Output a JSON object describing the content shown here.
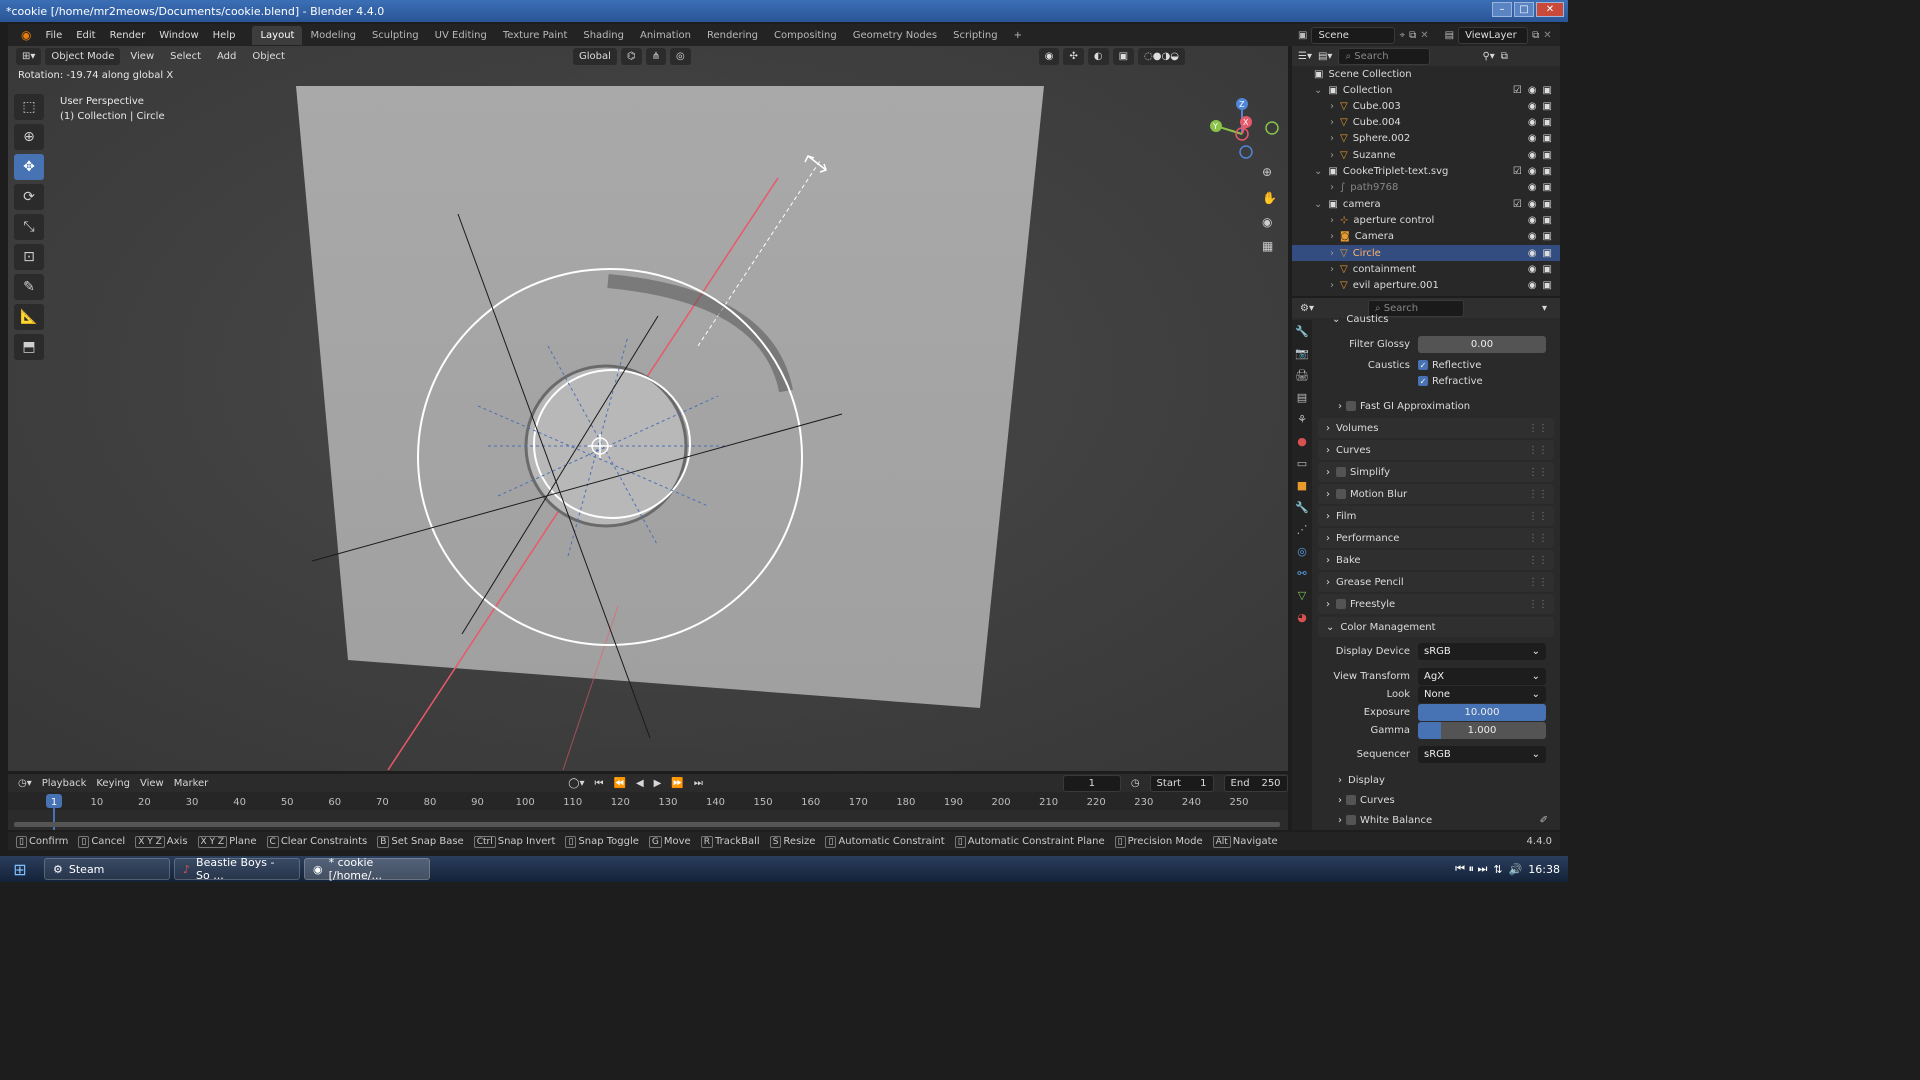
{
  "window": {
    "title": "*cookie [/home/mr2meows/Documents/cookie.blend] - Blender 4.4.0"
  },
  "menu": [
    "File",
    "Edit",
    "Render",
    "Window",
    "Help"
  ],
  "workspaces": [
    "Layout",
    "Modeling",
    "Sculpting",
    "UV Editing",
    "Texture Paint",
    "Shading",
    "Animation",
    "Rendering",
    "Compositing",
    "Geometry Nodes",
    "Scripting"
  ],
  "active_workspace": "Layout",
  "scene": {
    "scene_name": "Scene",
    "view_layer": "ViewLayer"
  },
  "viewport": {
    "mode": "Object Mode",
    "menus": [
      "View",
      "Select",
      "Add",
      "Object"
    ],
    "transform_orientation": "Global",
    "operator_hint": "Rotation: -19.74 along global X",
    "perspective": "User Perspective",
    "context": "(1) Collection | Circle",
    "gizmo_axes": {
      "x": "X",
      "y": "Y",
      "z": "Z"
    }
  },
  "outliner": {
    "search_placeholder": "Search",
    "root": "Scene Collection",
    "rows": [
      {
        "label": "Collection",
        "indent": 1,
        "kind": "collection"
      },
      {
        "label": "Cube.003",
        "indent": 2,
        "kind": "mesh"
      },
      {
        "label": "Cube.004",
        "indent": 2,
        "kind": "mesh"
      },
      {
        "label": "Sphere.002",
        "indent": 2,
        "kind": "mesh"
      },
      {
        "label": "Suzanne",
        "indent": 2,
        "kind": "mesh"
      },
      {
        "label": "CookeTriplet-text.svg",
        "indent": 1,
        "kind": "collection"
      },
      {
        "label": "path9768",
        "indent": 2,
        "kind": "curve"
      },
      {
        "label": "camera",
        "indent": 1,
        "kind": "collection"
      },
      {
        "label": "aperture control",
        "indent": 2,
        "kind": "empty"
      },
      {
        "label": "Camera",
        "indent": 2,
        "kind": "camera"
      },
      {
        "label": "Circle",
        "indent": 2,
        "kind": "mesh",
        "selected": true
      },
      {
        "label": "containment",
        "indent": 2,
        "kind": "mesh"
      },
      {
        "label": "evil aperture.001",
        "indent": 2,
        "kind": "mesh"
      }
    ]
  },
  "properties": {
    "search_placeholder": "Search",
    "caustics_header": "Caustics",
    "filter_glossy_label": "Filter Glossy",
    "filter_glossy_value": "0.00",
    "caustics_label": "Caustics",
    "reflective": "Reflective",
    "refractive": "Refractive",
    "fast_gi": "Fast GI Approximation",
    "panels": [
      "Volumes",
      "Curves",
      "Simplify",
      "Motion Blur",
      "Film",
      "Performance",
      "Bake",
      "Grease Pencil",
      "Freestyle"
    ],
    "color_management": {
      "header": "Color Management",
      "display_device_label": "Display Device",
      "display_device": "sRGB",
      "view_transform_label": "View Transform",
      "view_transform": "AgX",
      "look_label": "Look",
      "look": "None",
      "exposure_label": "Exposure",
      "exposure": "10.000",
      "gamma_label": "Gamma",
      "gamma": "1.000",
      "sequencer_label": "Sequencer",
      "sequencer": "sRGB",
      "subpanels": [
        "Display",
        "Curves",
        "White Balance"
      ]
    }
  },
  "timeline": {
    "menus": [
      "Playback",
      "Keying",
      "View",
      "Marker"
    ],
    "current_frame": "1",
    "start_label": "Start",
    "start": "1",
    "end_label": "End",
    "end": "250",
    "ticks": [
      "1",
      "10",
      "20",
      "30",
      "40",
      "50",
      "60",
      "70",
      "80",
      "90",
      "100",
      "110",
      "120",
      "130",
      "140",
      "150",
      "160",
      "170",
      "180",
      "190",
      "200",
      "210",
      "220",
      "230",
      "240",
      "250"
    ]
  },
  "statusbar": {
    "items": [
      {
        "key": "",
        "label": "Confirm"
      },
      {
        "key": "",
        "label": "Cancel"
      },
      {
        "key": "X Y Z",
        "label": "Axis"
      },
      {
        "key": "X Y Z",
        "label": "Plane"
      },
      {
        "key": "C",
        "label": "Clear Constraints"
      },
      {
        "key": "B",
        "label": "Set Snap Base"
      },
      {
        "key": "Ctrl",
        "label": "Snap Invert"
      },
      {
        "key": "",
        "label": "Snap Toggle"
      },
      {
        "key": "G",
        "label": "Move"
      },
      {
        "key": "R",
        "label": "TrackBall"
      },
      {
        "key": "S",
        "label": "Resize"
      },
      {
        "key": "",
        "label": "Automatic Constraint"
      },
      {
        "key": "",
        "label": "Automatic Constraint Plane"
      },
      {
        "key": "",
        "label": "Precision Mode"
      },
      {
        "key": "Alt",
        "label": "Navigate"
      }
    ],
    "version": "4.4.0"
  },
  "taskbar": {
    "tasks": [
      "Steam",
      "Beastie Boys - So ...",
      "* cookie [/home/..."
    ],
    "clock": "16:38"
  },
  "colors": {
    "accent": "#4772b3",
    "selected_row": "#334d80",
    "x_axis": "#e8596a",
    "y_axis": "#8bc34a",
    "z_axis": "#4f86d8"
  }
}
